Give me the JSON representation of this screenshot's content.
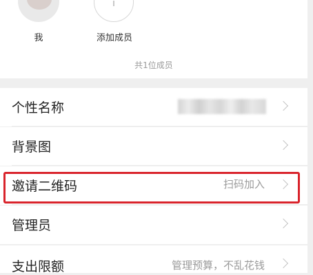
{
  "members": {
    "items": [
      {
        "label": "我"
      },
      {
        "label": "添加成员"
      }
    ],
    "count_text": "共1位成员"
  },
  "settings": [
    {
      "label": "个性名称",
      "value": "",
      "value_blurred": true
    },
    {
      "label": "背景图",
      "value": ""
    },
    {
      "label": "邀请二维码",
      "value": "扫码加入",
      "highlighted": true
    },
    {
      "label": "管理员",
      "value": ""
    },
    {
      "label": "支出限额",
      "value": "管理预算，不乱花钱"
    }
  ],
  "icons": {
    "chevron": "chevron-right-icon",
    "add": "add-member-icon"
  },
  "colors": {
    "highlight": "#d9232b",
    "background": "#efefef",
    "secondary_text": "#9a9a9a"
  }
}
